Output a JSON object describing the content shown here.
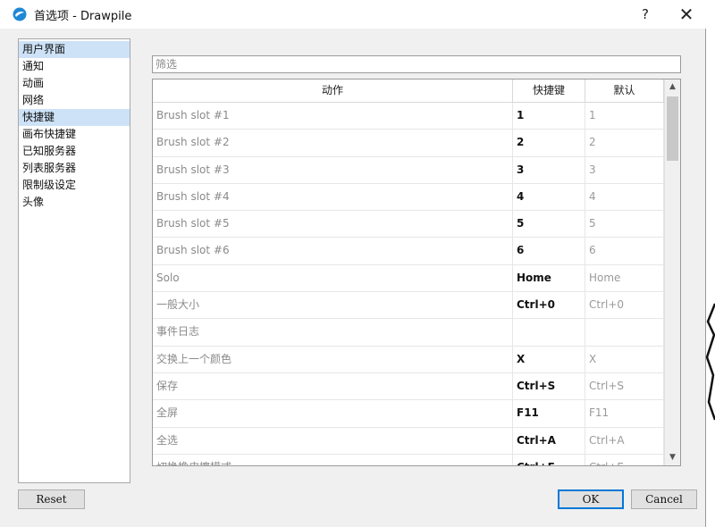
{
  "window": {
    "title": "首选项 - Drawpile",
    "help_label": "?",
    "close_label": "✕"
  },
  "icons": {
    "app": "drawpile-app-icon",
    "help": "help-icon",
    "close": "close-icon",
    "scroll_up": "scroll-up-arrow-icon",
    "scroll_down": "scroll-down-arrow-icon"
  },
  "sidebar": {
    "items": [
      {
        "label": "用户界面"
      },
      {
        "label": "通知"
      },
      {
        "label": "动画"
      },
      {
        "label": "网络"
      },
      {
        "label": "快捷键"
      },
      {
        "label": "画布快捷键"
      },
      {
        "label": "已知服务器"
      },
      {
        "label": "列表服务器"
      },
      {
        "label": "限制级设定"
      },
      {
        "label": "头像"
      }
    ],
    "selected": "快捷键"
  },
  "filter": {
    "placeholder": "筛选",
    "value": ""
  },
  "table": {
    "headers": {
      "action": "动作",
      "shortcut": "快捷键",
      "default": "默认"
    },
    "rows": [
      {
        "action": "Brush slot #1",
        "shortcut": "1",
        "default": "1"
      },
      {
        "action": "Brush slot #2",
        "shortcut": "2",
        "default": "2"
      },
      {
        "action": "Brush slot #3",
        "shortcut": "3",
        "default": "3"
      },
      {
        "action": "Brush slot #4",
        "shortcut": "4",
        "default": "4"
      },
      {
        "action": "Brush slot #5",
        "shortcut": "5",
        "default": "5"
      },
      {
        "action": "Brush slot #6",
        "shortcut": "6",
        "default": "6"
      },
      {
        "action": "Solo",
        "shortcut": "Home",
        "default": "Home"
      },
      {
        "action": "一般大小",
        "shortcut": "Ctrl+0",
        "default": "Ctrl+0"
      },
      {
        "action": "事件日志",
        "shortcut": "",
        "default": ""
      },
      {
        "action": "交换上一个颜色",
        "shortcut": "X",
        "default": "X"
      },
      {
        "action": "保存",
        "shortcut": "Ctrl+S",
        "default": "Ctrl+S"
      },
      {
        "action": "全屏",
        "shortcut": "F11",
        "default": "F11"
      },
      {
        "action": "全选",
        "shortcut": "Ctrl+A",
        "default": "Ctrl+A"
      },
      {
        "action": "切换橡皮擦模式",
        "shortcut": "Ctrl+E",
        "default": "Ctrl+E"
      }
    ]
  },
  "buttons": {
    "reset": "Reset",
    "ok": "OK",
    "cancel": "Cancel"
  },
  "colors": {
    "selection": "#cde2f7",
    "accent": "#0078d7",
    "dialog_bg": "#f0f0f0"
  }
}
